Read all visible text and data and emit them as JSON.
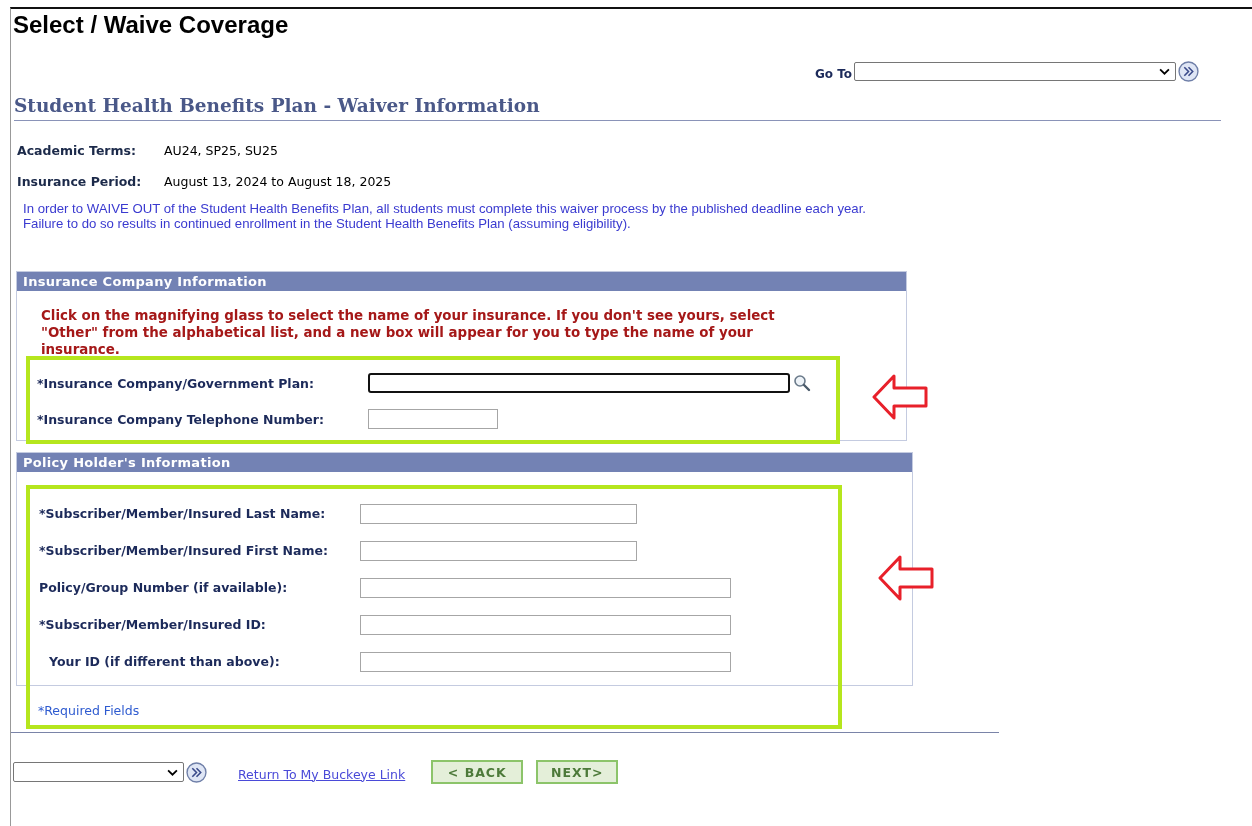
{
  "page_title": "Select / Waive Coverage",
  "goto": {
    "label": "Go To"
  },
  "heading": "Student Health Benefits Plan - Waiver Information",
  "info": [
    {
      "label": "Academic Terms:",
      "value": "AU24, SP25, SU25"
    },
    {
      "label": "Insurance Period:",
      "value": "August 13, 2024 to August 18, 2025"
    }
  ],
  "notice": "In order to WAIVE OUT of the Student Health Benefits Plan, all students must complete this waiver process by the published deadline each year.  Failure to do so results in continued enrollment in the Student Health Benefits Plan (assuming eligibility).",
  "sections": [
    {
      "title": "Insurance Company Information",
      "highlighted": true,
      "instruction": "Click on the magnifying glass to select the name of your insurance. If you don't see yours, select \"Other\" from the alphabetical list, and a new box will appear for you to type the name of your insurance.",
      "fields": [
        {
          "label": "*Insurance Company/Government Plan:",
          "kind": "wide",
          "focused": true,
          "lookup": true,
          "indented": false
        },
        {
          "label": "*Insurance Company Telephone Number:",
          "kind": "short",
          "focused": false,
          "lookup": false,
          "indented": false
        }
      ]
    },
    {
      "title": "Policy Holder's Information",
      "highlighted": true,
      "fields": [
        {
          "label": "*Subscriber/Member/Insured Last Name:",
          "kind": "medium",
          "focused": false,
          "lookup": false,
          "indented": false
        },
        {
          "label": "*Subscriber/Member/Insured First Name:",
          "kind": "medium",
          "focused": false,
          "lookup": false,
          "indented": false
        },
        {
          "label": "Policy/Group Number (if available):",
          "kind": "long",
          "focused": false,
          "lookup": false,
          "indented": false
        },
        {
          "label": "*Subscriber/Member/Insured ID:",
          "kind": "long",
          "focused": false,
          "lookup": false,
          "indented": false
        },
        {
          "label": "Your ID (if different than above):",
          "kind": "long",
          "focused": false,
          "lookup": false,
          "indented": true
        }
      ]
    }
  ],
  "required_note": "*Required Fields",
  "footer": {
    "link": "Return To My Buckeye Link",
    "buttons": [
      "< BACK",
      "NEXT>"
    ]
  }
}
